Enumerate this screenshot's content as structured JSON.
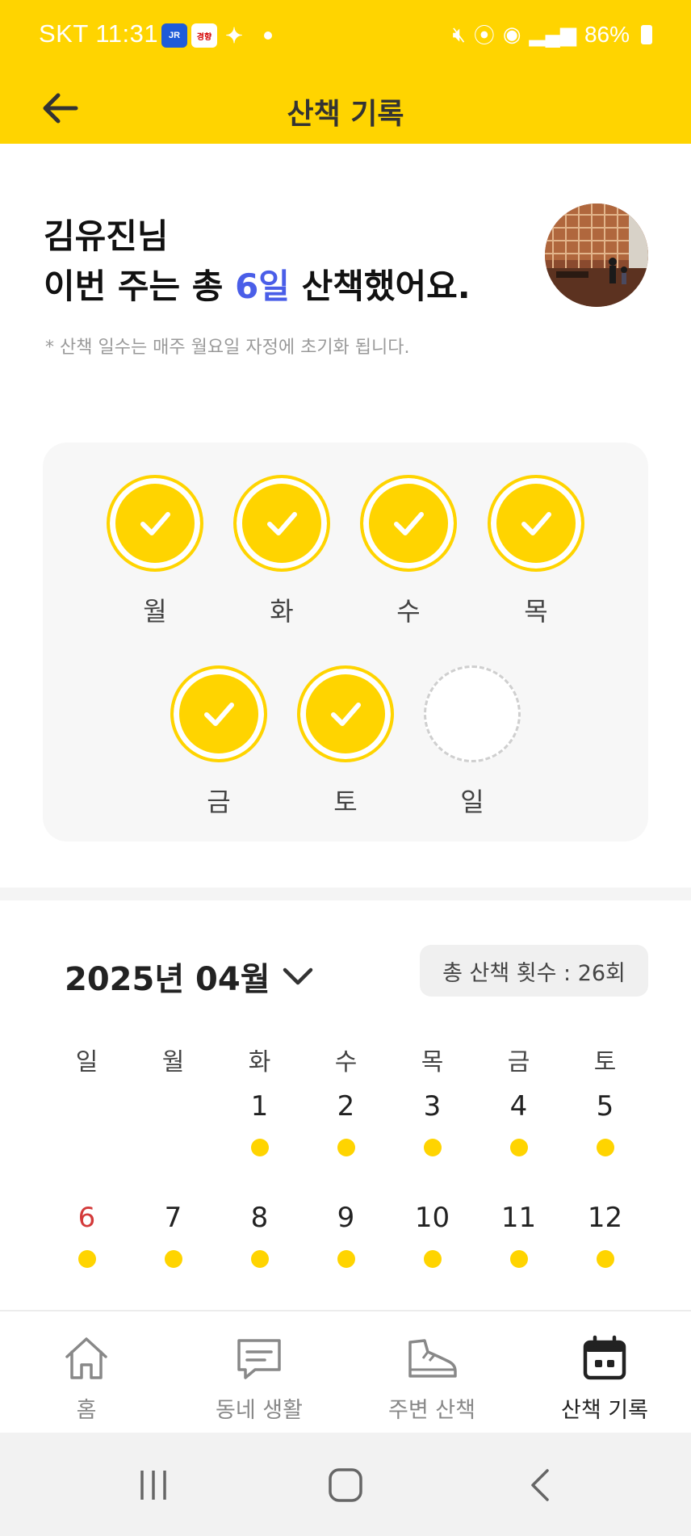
{
  "status_bar": {
    "carrier_time": "SKT 11:31",
    "app_icons": [
      "JR",
      "경향",
      "figure"
    ],
    "battery": "86%"
  },
  "app_bar": {
    "title": "산책 기록"
  },
  "summary": {
    "name_line": "김유진님",
    "walk_prefix": "이번 주는 총 ",
    "walk_days": "6일",
    "walk_suffix": " 산책했어요.",
    "reset_note": "* 산책 일수는 매주 월요일 자정에 초기화 됩니다."
  },
  "week": {
    "days": [
      {
        "label": "월",
        "done": true
      },
      {
        "label": "화",
        "done": true
      },
      {
        "label": "수",
        "done": true
      },
      {
        "label": "목",
        "done": true
      },
      {
        "label": "금",
        "done": true
      },
      {
        "label": "토",
        "done": true
      },
      {
        "label": "일",
        "done": false
      }
    ]
  },
  "calendar": {
    "month_label": "2025년 04월",
    "total_walks": "총 산책 횟수 : 26회",
    "weekdays": [
      "일",
      "월",
      "화",
      "수",
      "목",
      "금",
      "토"
    ],
    "dates": [
      "",
      "",
      "1",
      "2",
      "3",
      "4",
      "5",
      "6",
      "7",
      "8",
      "9",
      "10",
      "11",
      "12"
    ],
    "walked": [
      false,
      false,
      true,
      true,
      true,
      true,
      true,
      true,
      true,
      true,
      true,
      true,
      true,
      true
    ]
  },
  "bottom_nav": {
    "items": [
      {
        "label": "홈",
        "icon": "home-icon",
        "active": false
      },
      {
        "label": "동네 생활",
        "icon": "chat-icon",
        "active": false
      },
      {
        "label": "주변 산책",
        "icon": "shoe-icon",
        "active": false
      },
      {
        "label": "산책 기록",
        "icon": "calendar-icon",
        "active": true
      }
    ]
  },
  "colors": {
    "accent": "#FFD400",
    "highlight": "#4a5ee8",
    "sunday": "#d33a3a"
  }
}
